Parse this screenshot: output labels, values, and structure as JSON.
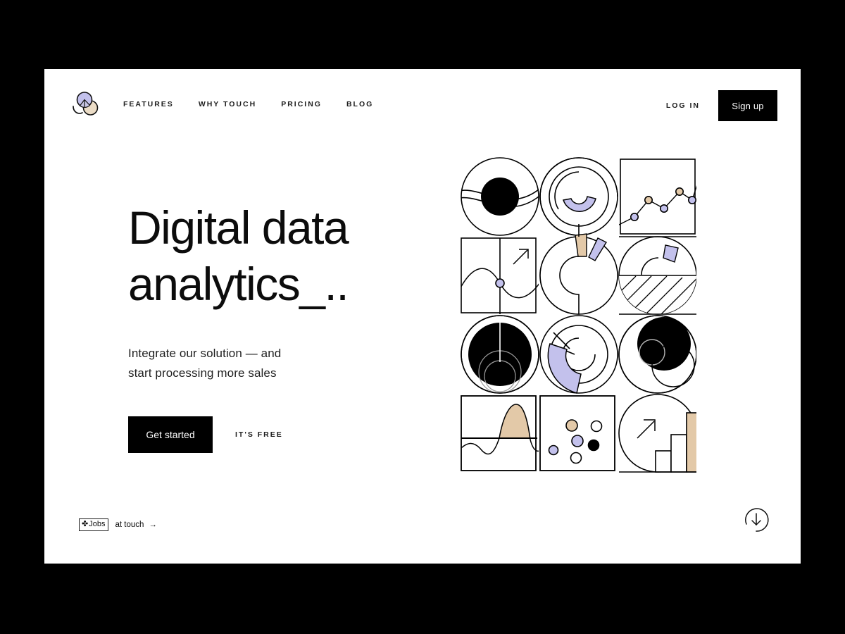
{
  "theme": {
    "page_background": "#000000",
    "card_background": "#ffffff",
    "ink": "#000000",
    "accent_purple": "#C3C1EC",
    "accent_tan": "#E3C9A8"
  },
  "header": {
    "logo_name": "touch-logo",
    "nav_items": [
      {
        "label": "FEATURES",
        "name": "nav-features"
      },
      {
        "label": "WHY TOUCH",
        "name": "nav-why-touch"
      },
      {
        "label": "PRICING",
        "name": "nav-pricing"
      },
      {
        "label": "BLOG",
        "name": "nav-blog"
      }
    ],
    "login_label": "LOG IN",
    "signup_label": "Sign up"
  },
  "hero": {
    "title": "Digital data\nanalytics_..",
    "subtitle": "Integrate our solution — and\nstart processing more sales",
    "cta_label": "Get started",
    "cta_note": "IT'S FREE"
  },
  "footer": {
    "jobs_badge_glyph": "✤",
    "jobs_badge_label": "Jobs",
    "at_touch_label": "at touch",
    "arrow_glyph": "→",
    "scroll_down_icon": "arrow-down-circle-icon"
  },
  "illustration": {
    "name": "data-analytics-collage",
    "description": "4x3 grid collage of abstract data-visualization tiles",
    "tiles": [
      {
        "row": 1,
        "col": 1,
        "name": "circle-with-black-sphere-and-swoosh"
      },
      {
        "row": 1,
        "col": 2,
        "name": "concentric-arcs-with-purple-donut-segment"
      },
      {
        "row": 1,
        "col": 3,
        "name": "line-chart-tile"
      },
      {
        "row": 2,
        "col": 1,
        "name": "wave-curve-with-purple-node-and-arrow"
      },
      {
        "row": 2,
        "col": 2,
        "name": "donut-with-tan-and-purple-slices"
      },
      {
        "row": 2,
        "col": 3,
        "name": "hatched-square-with-purple-slice"
      },
      {
        "row": 3,
        "col": 1,
        "name": "black-sphere-with-rings"
      },
      {
        "row": 3,
        "col": 2,
        "name": "spiral-with-purple-arc"
      },
      {
        "row": 3,
        "col": 3,
        "name": "overlapping-black-circles"
      },
      {
        "row": 4,
        "col": 1,
        "name": "area-wave-with-tan-fill"
      },
      {
        "row": 4,
        "col": 2,
        "name": "scatter-dots-tile"
      },
      {
        "row": 4,
        "col": 3,
        "name": "bar-chart-with-tan-bar-and-arrow"
      }
    ]
  },
  "chart_data": [
    {
      "type": "line",
      "title": "line-chart-tile",
      "x": [
        0,
        1,
        2,
        3,
        4,
        5,
        6
      ],
      "values": [
        8,
        22,
        52,
        38,
        66,
        52,
        100
      ],
      "point_colors": [
        "none",
        "#C3C1EC",
        "#E3C9A8",
        "#C3C1EC",
        "#E3C9A8",
        "#C3C1EC",
        "none"
      ],
      "grid": false,
      "legend": "none",
      "xlabel": "",
      "ylabel": ""
    },
    {
      "type": "bar",
      "title": "bar-chart-with-tan-bar-and-arrow",
      "categories": [
        "1",
        "2",
        "3"
      ],
      "values": [
        26,
        56,
        100
      ],
      "bar_colors": [
        "#ffffff",
        "#ffffff",
        "#E3C9A8"
      ],
      "grid": false,
      "legend": "none"
    },
    {
      "type": "scatter",
      "title": "scatter-dots-tile",
      "points": [
        {
          "x": 14,
          "y": 42,
          "color": "#C3C1EC",
          "r": 7
        },
        {
          "x": 39,
          "y": 68,
          "color": "#E3C9A8",
          "r": 9
        },
        {
          "x": 47,
          "y": 47,
          "color": "#C3C1EC",
          "r": 9
        },
        {
          "x": 46,
          "y": 25,
          "color": "#ffffff",
          "r": 8
        },
        {
          "x": 65,
          "y": 69,
          "color": "#ffffff",
          "r": 8
        },
        {
          "x": 67,
          "y": 40,
          "color": "#000000",
          "r": 8
        }
      ],
      "grid": false,
      "legend": "none"
    },
    {
      "type": "area",
      "title": "area-wave-with-tan-fill",
      "x": [
        0,
        12,
        25,
        38,
        50,
        62,
        75,
        88,
        100
      ],
      "values": [
        42,
        50,
        36,
        40,
        66,
        92,
        66,
        30,
        46
      ],
      "fill_color": "#E3C9A8",
      "baseline": 55,
      "grid": false,
      "legend": "none"
    }
  ]
}
